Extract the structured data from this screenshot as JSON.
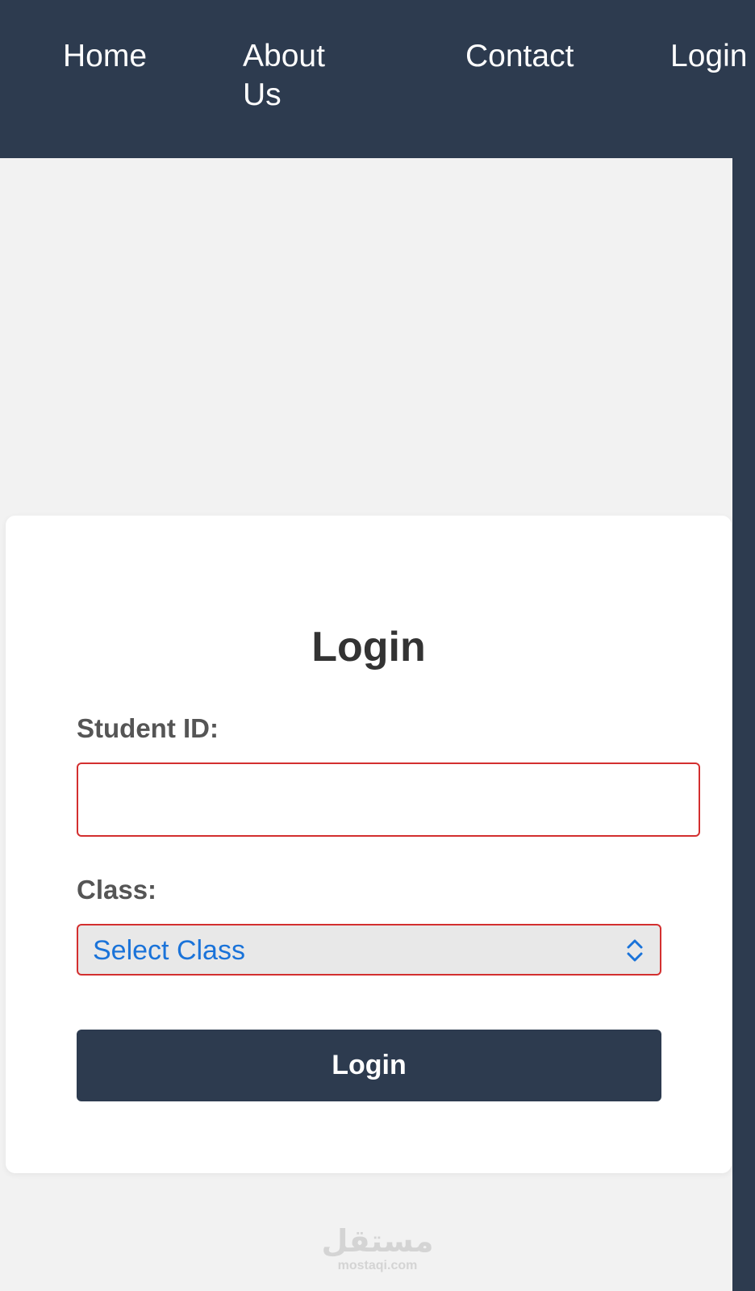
{
  "navbar": {
    "items": [
      {
        "label": "Home"
      },
      {
        "label": "About Us"
      },
      {
        "label": "Contact"
      },
      {
        "label": "Login"
      }
    ]
  },
  "login_form": {
    "title": "Login",
    "student_id": {
      "label": "Student ID:",
      "value": "",
      "placeholder": ""
    },
    "class_select": {
      "label": "Class:",
      "selected_value": "Select Class"
    },
    "submit_label": "Login"
  },
  "watermark": {
    "logo_text": "مستقل",
    "url_text": "mostaqi.com"
  },
  "colors": {
    "navbar_bg": "#2d3b4f",
    "page_bg": "#f2f2f2",
    "error_border": "#d32f2f",
    "select_text": "#1a73d9",
    "button_bg": "#2d3b4f"
  },
  "icons": {
    "select_indicator": "chevron-up-down-icon"
  }
}
